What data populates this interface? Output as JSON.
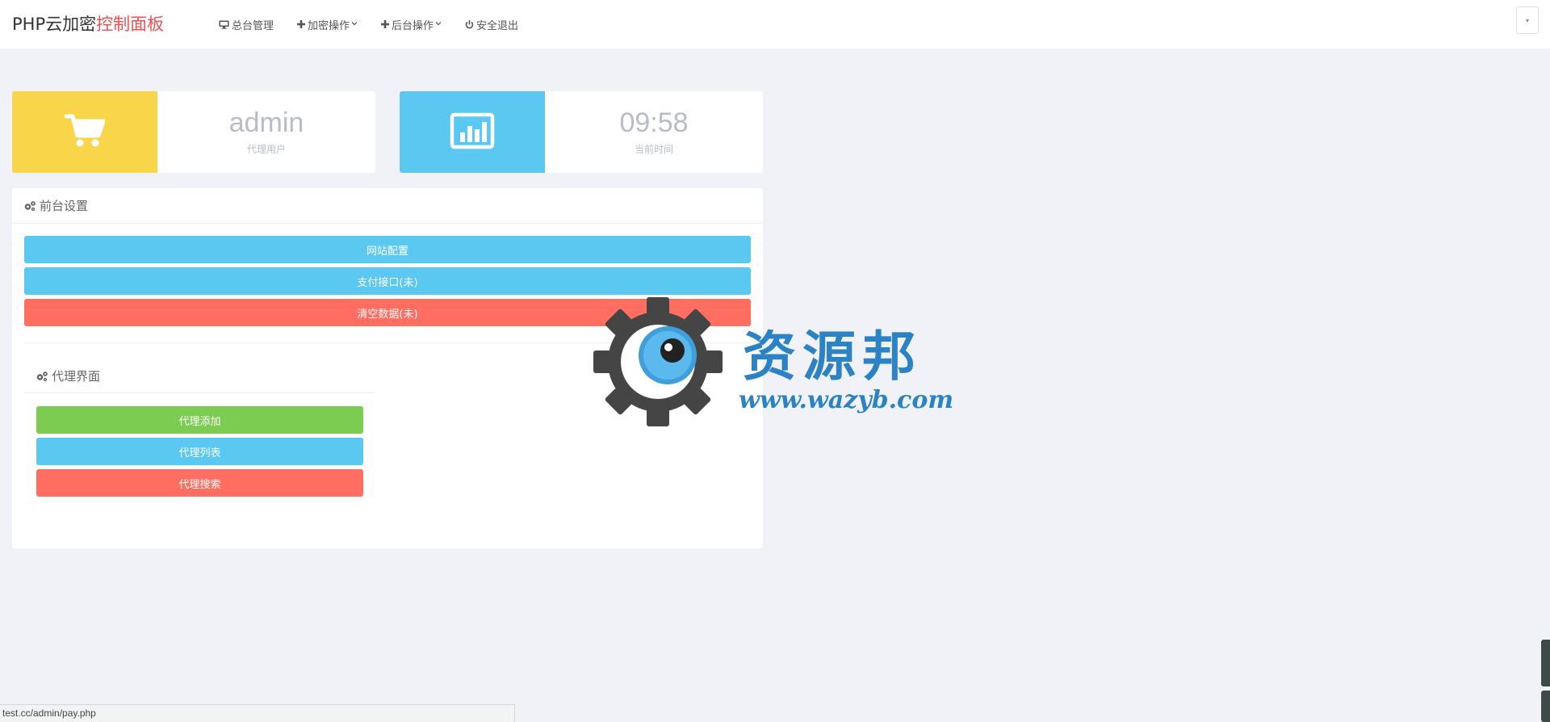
{
  "brand": {
    "prefix": "PHP云加密",
    "accent": "控制面板"
  },
  "nav": [
    {
      "label": "总台管理",
      "icon": "monitor-icon",
      "dropdown": false
    },
    {
      "label": "加密操作",
      "icon": "plus-icon",
      "dropdown": true
    },
    {
      "label": "后台操作",
      "icon": "plus-icon",
      "dropdown": true
    },
    {
      "label": "安全退出",
      "icon": "power-icon",
      "dropdown": false
    }
  ],
  "stats": [
    {
      "value": "admin",
      "label": "代理用户",
      "icon": "cart-icon",
      "color": "#f9d54a"
    },
    {
      "value": "09:58",
      "label": "当前时间",
      "icon": "bar-chart-icon",
      "color": "#5bc8f2"
    }
  ],
  "front_settings": {
    "title": "前台设置",
    "buttons": [
      {
        "label": "网站配置",
        "color": "#5bc8f2"
      },
      {
        "label": "支付接口(未)",
        "color": "#5bc8f2"
      },
      {
        "label": "清空数据(未)",
        "color": "#ff6e61"
      }
    ]
  },
  "agent_panel": {
    "title": "代理界面",
    "buttons": [
      {
        "label": "代理添加",
        "color": "#7ccc52"
      },
      {
        "label": "代理列表",
        "color": "#5bc8f2"
      },
      {
        "label": "代理搜索",
        "color": "#ff6e61"
      }
    ]
  },
  "watermark": {
    "name": "资源邦",
    "url": "www.wazyb.com"
  },
  "status_bar": {
    "url": "test.cc/admin/pay.php"
  }
}
